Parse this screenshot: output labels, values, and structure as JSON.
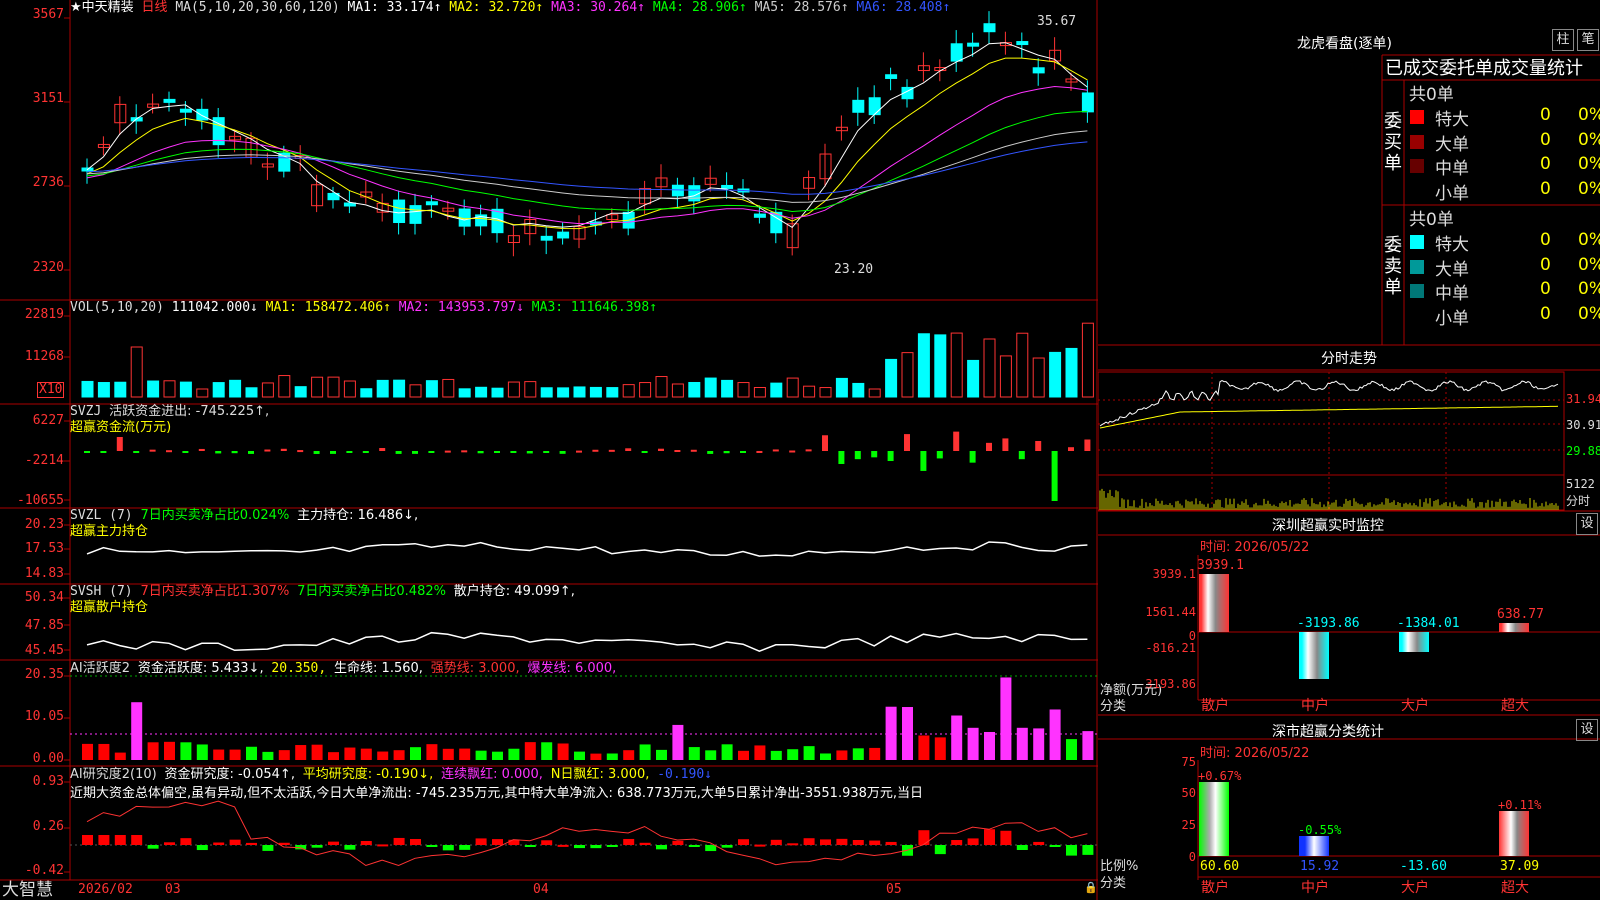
{
  "header": {
    "stock": "★中天精装",
    "period": "日线",
    "ma_def": "MA(5,10,20,30,60,120)",
    "ma": [
      {
        "label": "MA1:",
        "value": "33.174↑",
        "color": "#ffffff"
      },
      {
        "label": "MA2:",
        "value": "32.720↑",
        "color": "#ffff00"
      },
      {
        "label": "MA3:",
        "value": "30.264↑",
        "color": "#ff33ff"
      },
      {
        "label": "MA4:",
        "value": "28.906↑",
        "color": "#00ff00"
      },
      {
        "label": "MA5:",
        "value": "28.576↑",
        "color": "#cccccc"
      },
      {
        "label": "MA6:",
        "value": "28.408↑",
        "color": "#3355ff"
      }
    ]
  },
  "price_axis": [
    "3567",
    "3151",
    "2736",
    "2320"
  ],
  "price_marks": {
    "high": "35.67",
    "low": "23.20"
  },
  "vol": {
    "def": "VOL(5,10,20)",
    "value": "111042.000↓",
    "ma1": "MA1: 158472.406↑",
    "ma2": "MA2: 143953.797↓",
    "ma3": "MA3: 111646.398↑",
    "axis": [
      "22819",
      "11268"
    ],
    "unit": "X10"
  },
  "svzj": {
    "name": "SVZJ",
    "label": "活跃资金进出: -745.225↑,",
    "sub": "超赢资金流(万元)",
    "axis": [
      "6227",
      "-2214",
      "-10655"
    ]
  },
  "svzl": {
    "name": "SVZL (7)",
    "p1": "7日内买卖净占比0.024%",
    "p2": "主力持仓: 16.486↓,",
    "sub": "超赢主力持仓",
    "axis": [
      "20.23",
      "17.53",
      "14.83"
    ]
  },
  "svsh": {
    "name": "SVSH (7)",
    "p1": "7日内买卖净占比1.307%",
    "p2": "7日内买卖净占比0.482%",
    "p3": "散户持仓: 49.099↑,",
    "sub": "超赢散户持仓",
    "axis": [
      "50.34",
      "47.85",
      "45.45"
    ]
  },
  "ai2": {
    "name": "AI活跃度2",
    "p1": "资金活跃度: 5.433↓,",
    "p2": "20.350,",
    "p3": "生命线: 1.560,",
    "p4": "强势线: 3.000,",
    "p5": "爆发线: 6.000,",
    "axis": [
      "20.35",
      "10.05",
      "0.00"
    ]
  },
  "ai_res": {
    "name": "AI研究度2(10)",
    "p1": "资金研究度: -0.054↑,",
    "p2": "平均研究度: -0.190↓,",
    "p3": "连续飘红: 0.000,",
    "p4": "N日飘红: 3.000,",
    "p5": "-0.190↓",
    "text": "近期大资金总体偏空,虽有异动,但不太活跃,今日大单净流出: -745.235万元,其中特大单净流入: 638.773万元,大单5日累计净出-3551.938万元,当日",
    "axis": [
      "0.93",
      "0.26",
      "-0.42"
    ]
  },
  "xaxis": {
    "app": "大智慧",
    "dates": [
      "2026/02",
      "03",
      "04",
      "05"
    ]
  },
  "lhkp": {
    "title": "龙虎看盘(逐单)",
    "btn_zhu": "柱",
    "btn_bi": "笔",
    "tabs": "已成交委托单成交量统计",
    "buy_label": "委买单",
    "sell_label": "委卖单",
    "buy_total": "共0单",
    "sell_total": "共0单",
    "buy_rows": [
      {
        "name": "特大",
        "num": "0",
        "pct": "0%",
        "color": "#ff0000"
      },
      {
        "name": "大单",
        "num": "0",
        "pct": "0%",
        "color": "#990000"
      },
      {
        "name": "中单",
        "num": "0",
        "pct": "0%",
        "color": "#660000"
      },
      {
        "name": "小单",
        "num": "0",
        "pct": "0%",
        "color": ""
      }
    ],
    "sell_rows": [
      {
        "name": "特大",
        "num": "0",
        "pct": "0%",
        "color": "#00ffff"
      },
      {
        "name": "大单",
        "num": "0",
        "pct": "0%",
        "color": "#009999"
      },
      {
        "name": "中单",
        "num": "0",
        "pct": "0%",
        "color": "#007777"
      },
      {
        "name": "小单",
        "num": "0",
        "pct": "0%",
        "color": ""
      }
    ]
  },
  "fenshi": {
    "title": "分时走势",
    "axis": [
      "31.94",
      "30.91",
      "29.88"
    ],
    "vol_label": "5122",
    "unit": "分时"
  },
  "szmon": {
    "title": "深圳超赢实时监控",
    "btn": "设",
    "time": "时间: 2026/05/22",
    "axis": [
      "3939.1",
      "1561.44",
      "0",
      "-816.21",
      "-3193.86"
    ],
    "ylabel": "净额(万元)",
    "xlabel": "分类",
    "categories": [
      "散户",
      "中户",
      "大户",
      "超大"
    ],
    "values": [
      "3939.1",
      "-3193.86",
      "-1384.01",
      "638.77"
    ]
  },
  "szcls": {
    "title": "深市超赢分类统计",
    "btn": "设",
    "time": "时间: 2026/05/22",
    "axis": [
      "75",
      "50",
      "25",
      "0"
    ],
    "ylabel": "比例%",
    "xlabel": "分类",
    "categories": [
      "散户",
      "中户",
      "大户",
      "超大"
    ],
    "top": [
      "+0.67%",
      "-0.55%",
      "",
      "+0.11%"
    ],
    "bottom": [
      "60.60",
      "15.92",
      "-13.60",
      "37.09"
    ]
  }
}
